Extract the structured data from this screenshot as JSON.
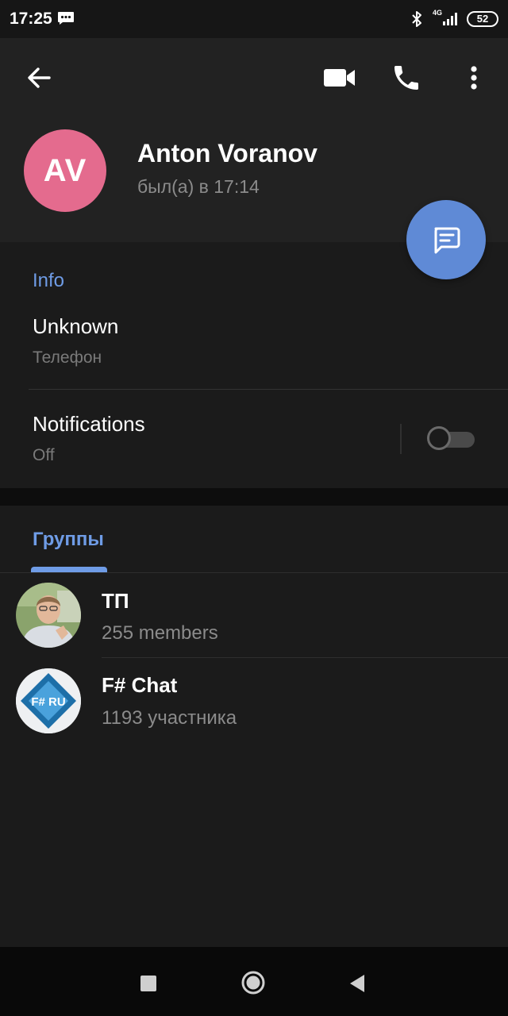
{
  "status_bar": {
    "time": "17:25",
    "network": "4G",
    "battery": "52"
  },
  "header": {
    "avatar_initials": "AV",
    "avatar_color": "#e46b8e",
    "name": "Anton Voranov",
    "last_seen": "был(а) в 17:14",
    "icons": [
      "back-arrow-icon",
      "video-call-icon",
      "phone-icon",
      "more-vert-icon",
      "message-icon"
    ]
  },
  "info": {
    "section_title": "Info",
    "phone_value": "Unknown",
    "phone_label": "Телефон",
    "notifications_title": "Notifications",
    "notifications_value": "Off",
    "notifications_enabled": false
  },
  "groups": {
    "tab_label": "Группы",
    "items": [
      {
        "name": "ТП",
        "subtitle": "255 members",
        "avatar": "photo"
      },
      {
        "name": "F# Chat",
        "subtitle": "1193 участника",
        "avatar": "F# RU logo",
        "logo_text": "F# RU"
      }
    ]
  },
  "colors": {
    "accent": "#6f9ce6",
    "fab": "#5f8ad6",
    "header_bg": "#222222",
    "body_bg": "#1b1b1b"
  },
  "nav_icons": [
    "recent-apps-icon",
    "home-icon",
    "back-icon"
  ]
}
